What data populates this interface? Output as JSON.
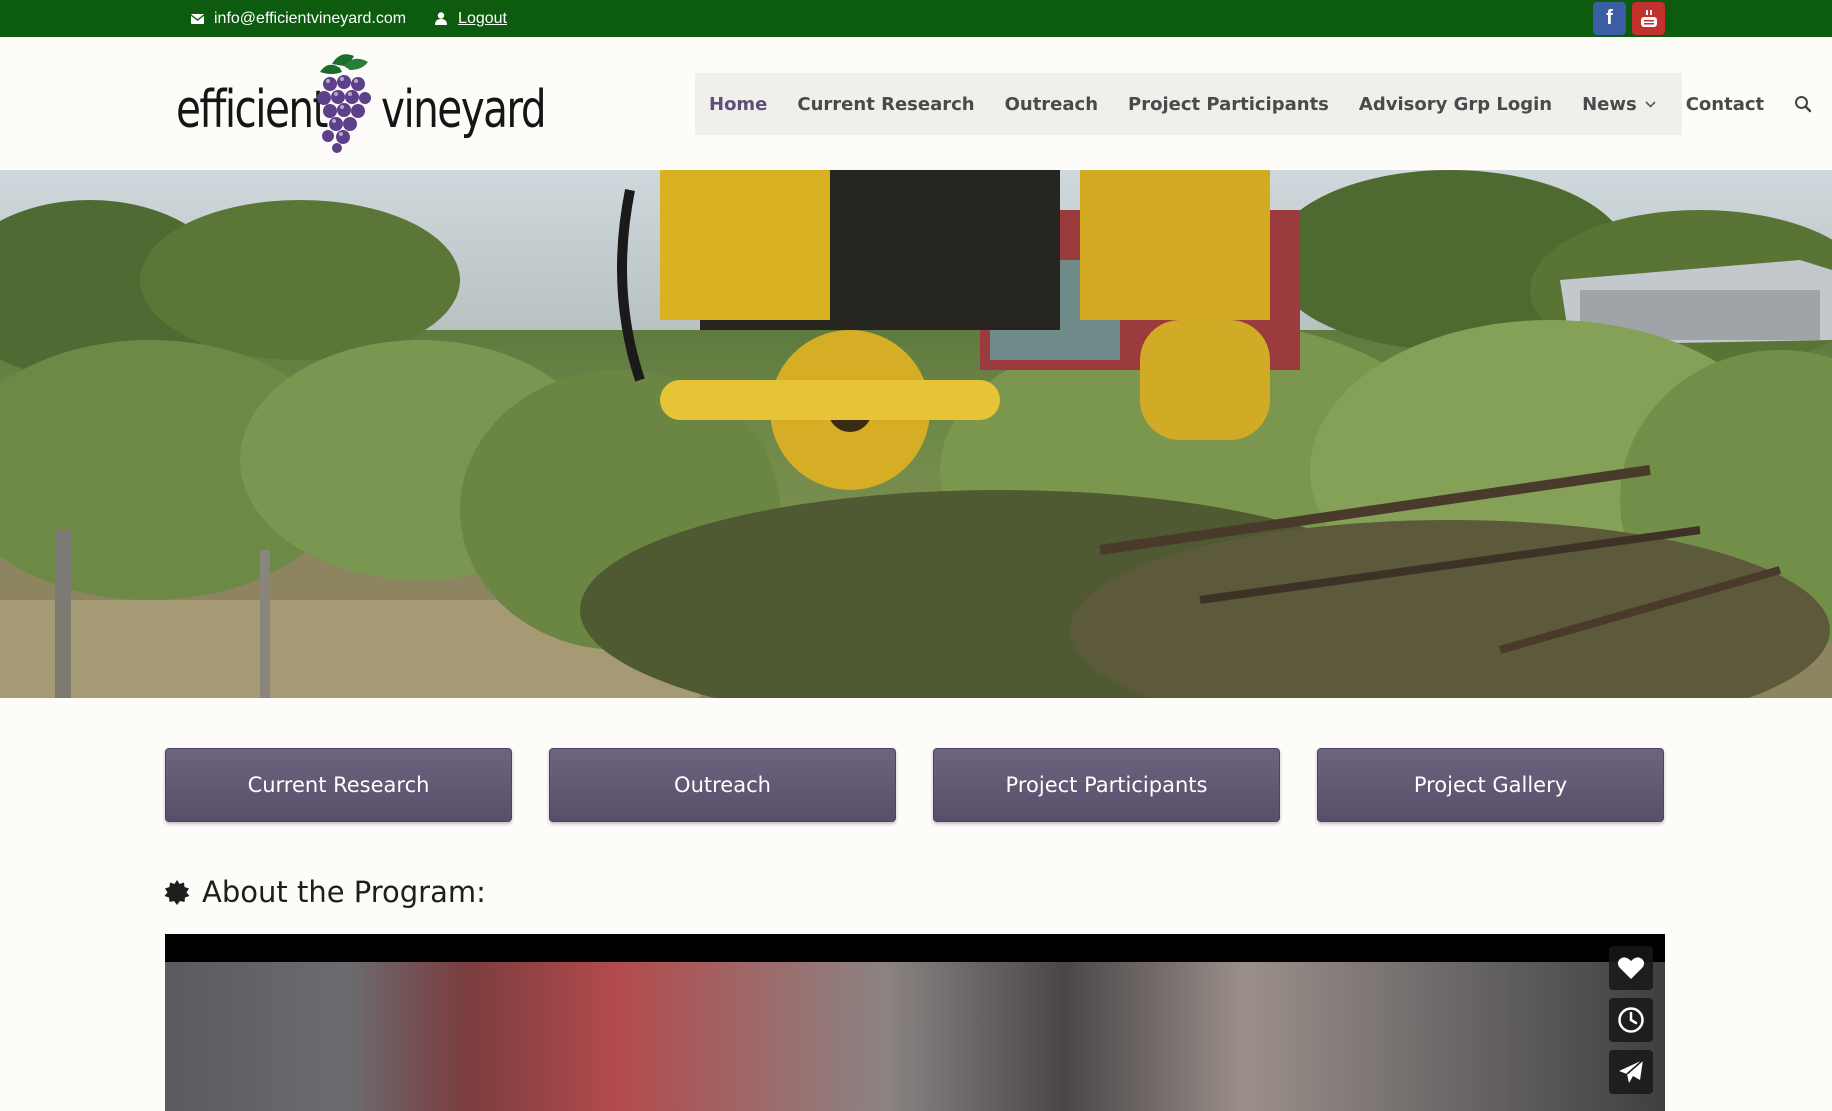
{
  "topbar": {
    "email": "info@efficientvineyard.com",
    "logout_label": "Logout",
    "icons": {
      "email": "envelope-icon",
      "user": "user-icon"
    },
    "social": [
      {
        "name": "facebook",
        "glyph": "f",
        "color": "#3b5da4"
      },
      {
        "name": "youtube",
        "glyph": "You",
        "color": "#c4302b"
      }
    ],
    "bg_color": "#0c5b0f"
  },
  "logo": {
    "word1": "efficient",
    "word2": "vineyard",
    "icon": "grape-cluster-icon"
  },
  "nav": {
    "items": [
      {
        "label": "Home",
        "active": true
      },
      {
        "label": "Current Research"
      },
      {
        "label": "Outreach"
      },
      {
        "label": "Project Participants"
      },
      {
        "label": "Advisory Grp Login"
      },
      {
        "label": "News",
        "dropdown": true
      },
      {
        "label": "Contact"
      }
    ],
    "search_icon": "search-icon",
    "active_color": "#5c4f78"
  },
  "hero": {
    "image": "vineyard-machine-photo"
  },
  "buttons": [
    {
      "label": "Current Research"
    },
    {
      "label": "Outreach"
    },
    {
      "label": "Project Participants"
    },
    {
      "label": "Project Gallery"
    }
  ],
  "section": {
    "title": "About the Program:",
    "icon": "badge-icon"
  },
  "video": {
    "controls": [
      "heart-icon",
      "clock-icon",
      "send-icon"
    ]
  },
  "colors": {
    "button": "#5f5773",
    "background": "#fdfcf9"
  }
}
